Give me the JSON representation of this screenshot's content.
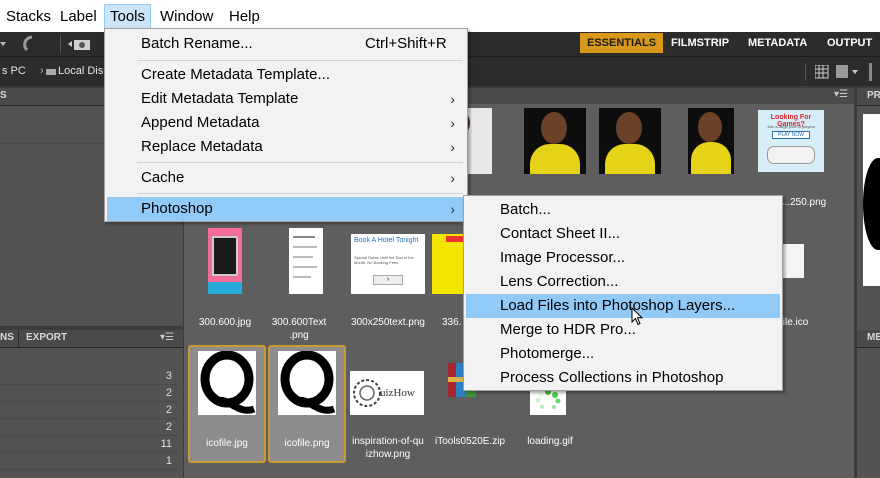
{
  "menubar": {
    "items": [
      "Stacks",
      "Label",
      "Tools",
      "Window",
      "Help"
    ]
  },
  "workspaces": [
    "ESSENTIALS",
    "FILMSTRIP",
    "METADATA",
    "OUTPUT"
  ],
  "path": {
    "segments": [
      "s PC",
      "Local Disk"
    ]
  },
  "left_panels": {
    "top_tab": "S",
    "bottom_tabs": [
      "NS",
      "EXPORT"
    ],
    "counts": [
      "3",
      "2",
      "2",
      "2",
      "11",
      "1"
    ]
  },
  "preview_tab": "PR",
  "bottom_right_tab": "ME",
  "thumbnails": {
    "row1_last_caption": "...250.png",
    "row2": [
      {
        "caption": "300.600.jpg"
      },
      {
        "caption": "300.600Text\n.png"
      },
      {
        "caption": "300x250text.png"
      },
      {
        "caption": "336."
      },
      {
        "caption": "file.ico"
      }
    ],
    "row3": [
      {
        "caption": "icofile.jpg"
      },
      {
        "caption": "icofile.png"
      },
      {
        "caption": "inspiration-of-qu\nizhow.png"
      },
      {
        "caption": "iTools0520E.zip"
      },
      {
        "caption": "loading.gif"
      }
    ],
    "ad_games": {
      "title": "Looking For Games?",
      "sub": "Join a large pool of players",
      "cta": "PLAY NOW"
    },
    "ad_hotel": {
      "title": "Book A Hotel Tonight",
      "body": "Special Rates Until the End of the Month. No Booking Fees."
    },
    "quizhow_text": "uizHow"
  },
  "tools_menu": {
    "items": [
      {
        "label": "Batch Rename...",
        "shortcut": "Ctrl+Shift+R"
      },
      {
        "label": "Create Metadata Template..."
      },
      {
        "label": "Edit Metadata Template",
        "submenu": true
      },
      {
        "label": "Append Metadata",
        "submenu": true
      },
      {
        "label": "Replace Metadata",
        "submenu": true
      },
      {
        "label": "Cache",
        "submenu": true
      },
      {
        "label": "Photoshop",
        "submenu": true,
        "highlighted": true
      }
    ]
  },
  "photoshop_menu": {
    "items": [
      {
        "label": "Batch..."
      },
      {
        "label": "Contact Sheet II..."
      },
      {
        "label": "Image Processor..."
      },
      {
        "label": "Lens Correction..."
      },
      {
        "label": "Load Files into Photoshop Layers...",
        "highlighted": true
      },
      {
        "label": "Merge to HDR Pro..."
      },
      {
        "label": "Photomerge..."
      },
      {
        "label": "Process Collections in Photoshop"
      }
    ]
  },
  "colors": {
    "accent": "#d99a1b",
    "highlight": "#91c9f7",
    "panel": "#535353",
    "content": "#5e5e5e"
  }
}
